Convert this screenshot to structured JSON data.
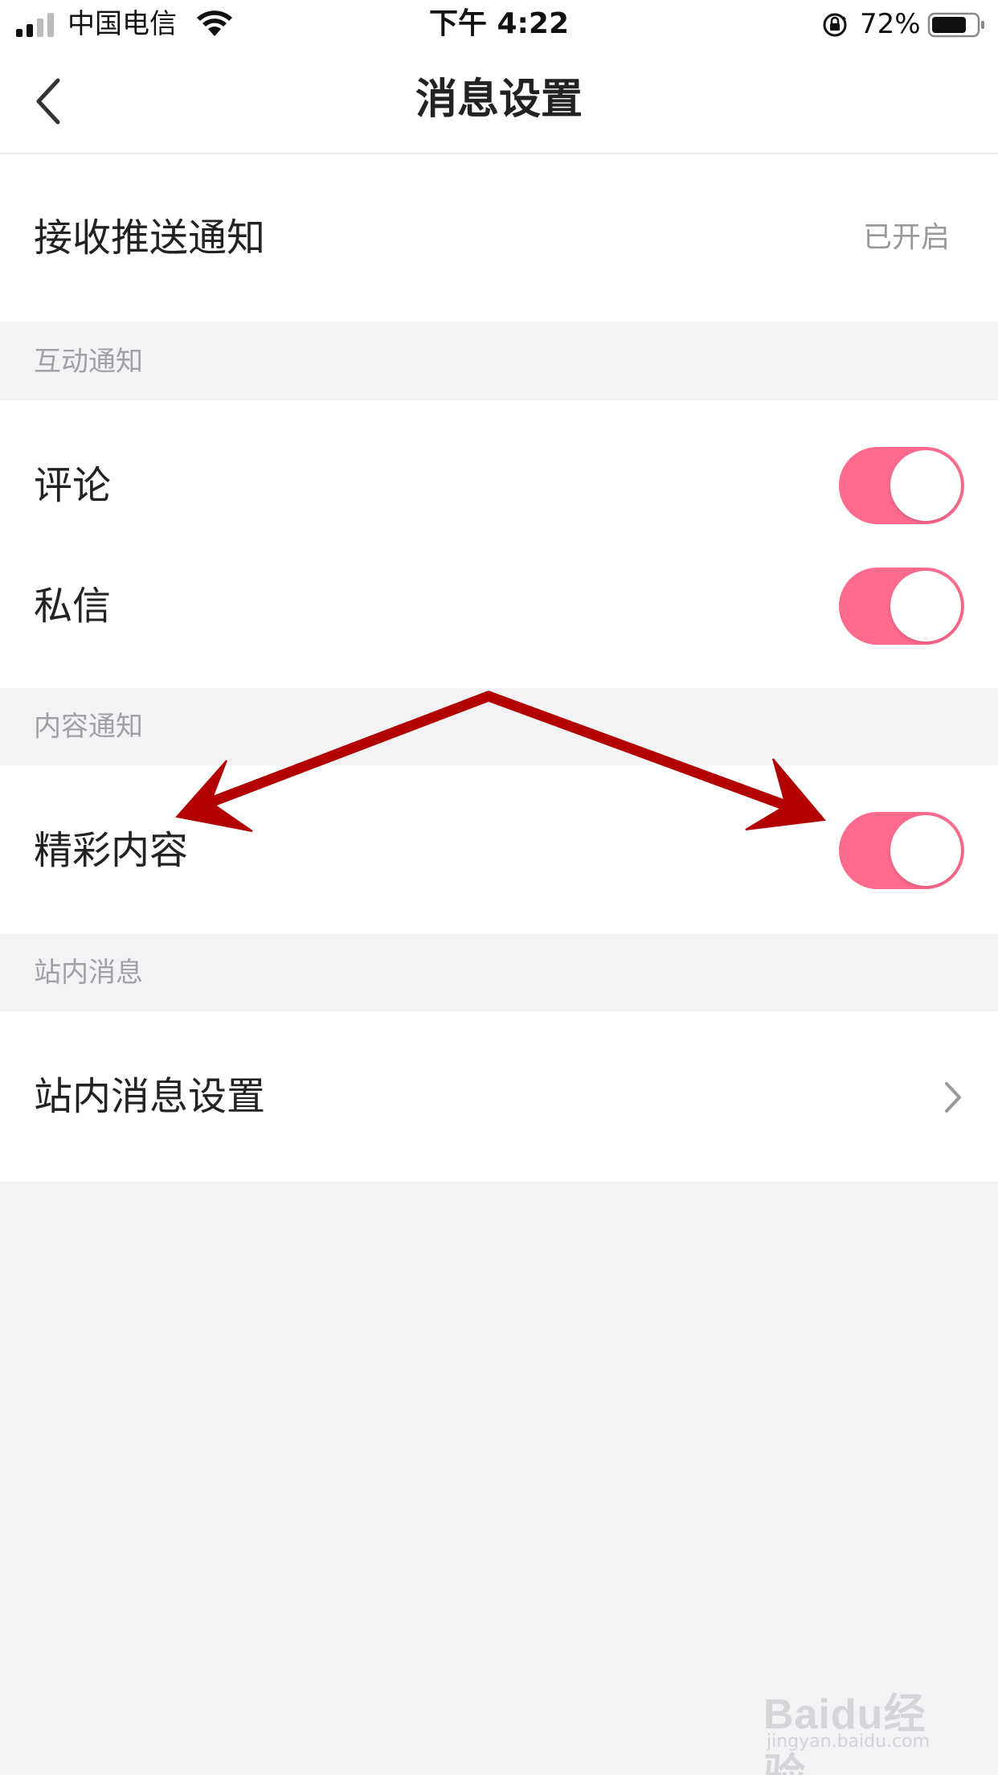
{
  "status_bar": {
    "carrier": "中国电信",
    "time": "下午 4:22",
    "battery_percent": "72%"
  },
  "nav": {
    "title": "消息设置"
  },
  "push": {
    "label": "接收推送通知",
    "value": "已开启"
  },
  "sections": {
    "interaction": {
      "header": "互动通知",
      "items": [
        {
          "label": "评论",
          "enabled": true
        },
        {
          "label": "私信",
          "enabled": true
        }
      ]
    },
    "content": {
      "header": "内容通知",
      "items": [
        {
          "label": "精彩内容",
          "enabled": true
        }
      ]
    },
    "site": {
      "header": "站内消息",
      "items": [
        {
          "label": "站内消息设置"
        }
      ]
    }
  },
  "colors": {
    "toggle_on": "#ff6a8d",
    "arrow": "#b30000",
    "section_bg": "#f3f3f5"
  },
  "icons": {
    "back": "chevron-left-icon",
    "disclosure": "chevron-right-icon",
    "signal": "signal-icon",
    "wifi": "wifi-icon",
    "lock": "rotation-lock-icon",
    "battery": "battery-icon"
  },
  "watermark": {
    "brand": "Baidu经验",
    "url": "jingyan.baidu.com"
  }
}
